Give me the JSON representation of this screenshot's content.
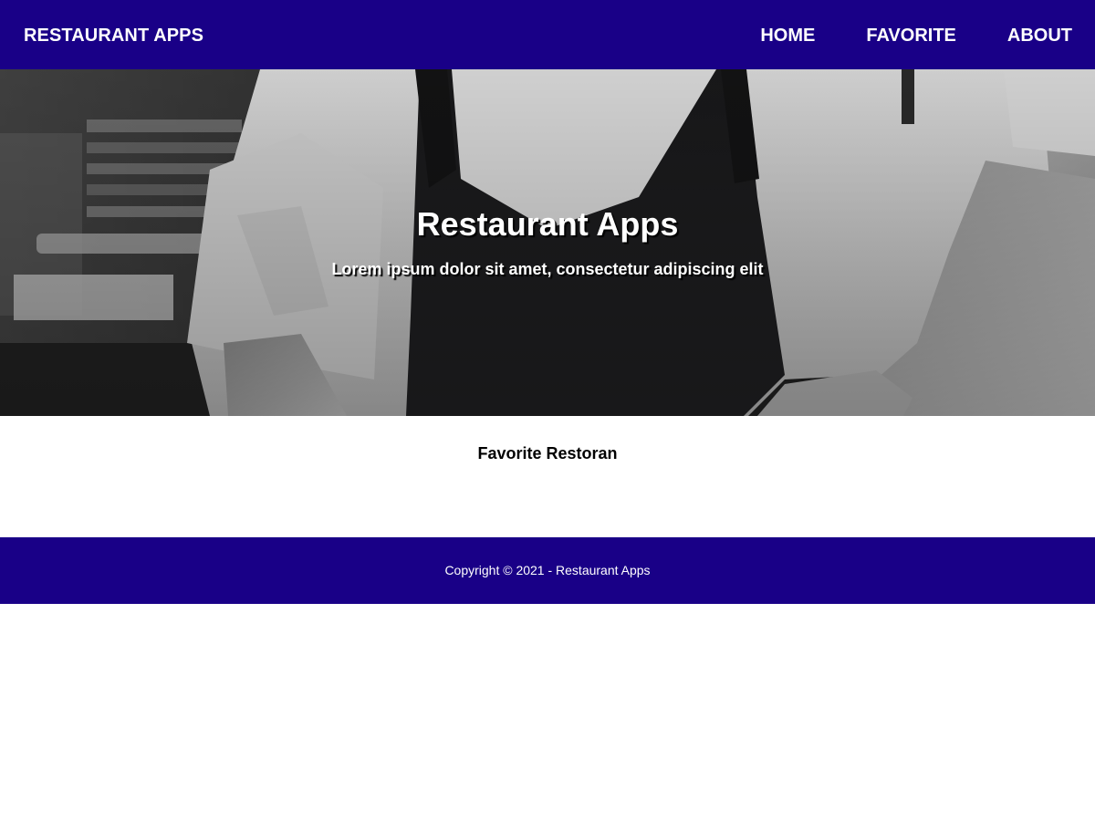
{
  "colors": {
    "brand": "#190087",
    "text_on_brand": "#ffffff",
    "page_background": "#ffffff"
  },
  "header": {
    "brand": "RESTAURANT APPS",
    "nav": [
      {
        "label": "HOME"
      },
      {
        "label": "FAVORITE"
      },
      {
        "label": "ABOUT"
      }
    ]
  },
  "hero": {
    "image": "grayscale photo of a chef in a white jacket and dark apron",
    "title": "Restaurant Apps",
    "subtitle": "Lorem ipsum dolor sit amet, consectetur adipiscing elit"
  },
  "main": {
    "section_title": "Favorite Restoran",
    "restaurants": []
  },
  "footer": {
    "copyright": "Copyright © 2021 - Restaurant Apps"
  }
}
